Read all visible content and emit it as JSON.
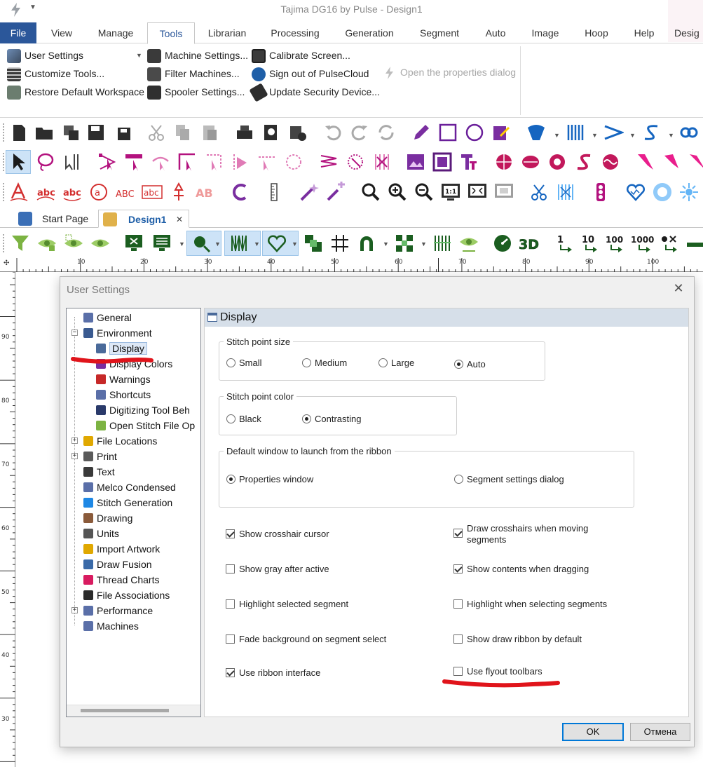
{
  "window": {
    "title": "Tajima DG16 by Pulse - Design1"
  },
  "ribbon_tabs": [
    "File",
    "View",
    "Manage",
    "Tools",
    "Librarian",
    "Processing",
    "Generation",
    "Segment",
    "Auto",
    "Image",
    "Hoop",
    "Help",
    "Desig"
  ],
  "active_ribbon_tab": "Tools",
  "ribbon": {
    "col1": [
      "User Settings",
      "Customize Tools...",
      "Restore Default Workspace"
    ],
    "col2": [
      "Machine Settings...",
      "Filter Machines...",
      "Spooler Settings..."
    ],
    "col3": [
      "Calibrate Screen...",
      "Sign out of PulseCloud",
      "Update Security Device..."
    ],
    "disabled_item": "Open the properties dialog"
  },
  "doc_tabs": {
    "start": "Start Page",
    "design": "Design1",
    "close": "✕"
  },
  "ruler": {
    "h_labels": [
      "10",
      "20",
      "30",
      "40",
      "50",
      "60",
      "70",
      "80",
      "90",
      "100"
    ],
    "v_labels": [
      "90",
      "80",
      "70",
      "60",
      "50",
      "40",
      "30"
    ]
  },
  "toolbar_labels": {
    "zoom_11": "1:1",
    "threeD": "3D",
    "n1": "1",
    "n10": "10",
    "n100": "100",
    "n1000": "1000"
  },
  "dialog": {
    "title": "User Settings",
    "close": "✕",
    "tree": [
      {
        "label": "General",
        "level": 1,
        "expander": ""
      },
      {
        "label": "Environment",
        "level": 1,
        "expander": "−"
      },
      {
        "label": "Display",
        "level": 2,
        "expander": "",
        "selected": true
      },
      {
        "label": "Display Colors",
        "level": 2,
        "expander": ""
      },
      {
        "label": "Warnings",
        "level": 2,
        "expander": ""
      },
      {
        "label": "Shortcuts",
        "level": 2,
        "expander": ""
      },
      {
        "label": "Digitizing Tool Beh",
        "level": 2,
        "expander": ""
      },
      {
        "label": "Open Stitch File Op",
        "level": 2,
        "expander": ""
      },
      {
        "label": "File Locations",
        "level": 1,
        "expander": "+"
      },
      {
        "label": "Print",
        "level": 1,
        "expander": "+"
      },
      {
        "label": "Text",
        "level": 1,
        "expander": ""
      },
      {
        "label": "Melco Condensed",
        "level": 1,
        "expander": ""
      },
      {
        "label": "Stitch Generation",
        "level": 1,
        "expander": ""
      },
      {
        "label": "Drawing",
        "level": 1,
        "expander": ""
      },
      {
        "label": "Units",
        "level": 1,
        "expander": ""
      },
      {
        "label": "Import Artwork",
        "level": 1,
        "expander": ""
      },
      {
        "label": "Draw Fusion",
        "level": 1,
        "expander": ""
      },
      {
        "label": "Thread Charts",
        "level": 1,
        "expander": ""
      },
      {
        "label": "File Associations",
        "level": 1,
        "expander": ""
      },
      {
        "label": "Performance",
        "level": 1,
        "expander": "+"
      },
      {
        "label": "Machines",
        "level": 1,
        "expander": ""
      }
    ],
    "panel_title": "Display",
    "stitch_point_size": {
      "label": "Stitch point size",
      "options": [
        "Small",
        "Medium",
        "Large",
        "Auto"
      ],
      "selected": "Auto"
    },
    "stitch_point_color": {
      "label": "Stitch point color",
      "options": [
        "Black",
        "Contrasting"
      ],
      "selected": "Contrasting"
    },
    "default_window": {
      "label": "Default window to launch from the ribbon",
      "options": [
        "Properties window",
        "Segment settings dialog"
      ],
      "selected": "Properties window"
    },
    "checkboxes_left": [
      {
        "label": "Show crosshair cursor",
        "checked": true
      },
      {
        "label": "Show gray after active",
        "checked": false
      },
      {
        "label": "Highlight selected segment",
        "checked": false
      },
      {
        "label": "Fade background on segment select",
        "checked": false
      },
      {
        "label": "Use ribbon interface",
        "checked": true
      }
    ],
    "checkboxes_right": [
      {
        "label": "Draw crosshairs when moving segments",
        "checked": true
      },
      {
        "label": "Show contents when dragging",
        "checked": true
      },
      {
        "label": "Highlight when selecting segments",
        "checked": false
      },
      {
        "label": "Show draw ribbon by default",
        "checked": false
      },
      {
        "label": "Use flyout toolbars",
        "checked": false
      }
    ],
    "ok": "OK",
    "cancel": "Отмена"
  },
  "colors": {
    "file_tab": "#2b579a",
    "accent": "#0078d7",
    "annotation": "#e0141b",
    "magenta": "#b3127e"
  }
}
